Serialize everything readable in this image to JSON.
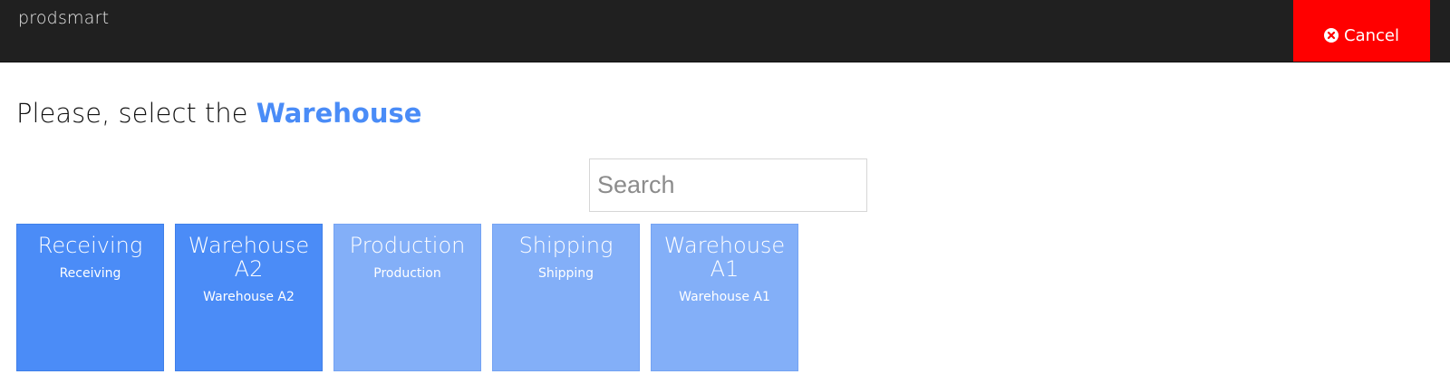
{
  "header": {
    "brand": "prodsmart",
    "cancel_label": "Cancel"
  },
  "heading": {
    "prefix": "Please, select the",
    "emphasis": "Warehouse"
  },
  "search": {
    "placeholder": "Search",
    "value": ""
  },
  "tiles": [
    {
      "title": "Receiving",
      "subtitle": "Receiving",
      "selected": true
    },
    {
      "title": "Warehouse A2",
      "subtitle": "Warehouse A2",
      "selected": true
    },
    {
      "title": "Production",
      "subtitle": "Production",
      "selected": false
    },
    {
      "title": "Shipping",
      "subtitle": "Shipping",
      "selected": false
    },
    {
      "title": "Warehouse A1",
      "subtitle": "Warehouse A1",
      "selected": false
    }
  ],
  "colors": {
    "topbar": "#202020",
    "cancel": "#ff0000",
    "accent": "#4a8cf7",
    "tile_dark": "#4b8cf7",
    "tile_light": "#83aff8"
  },
  "icons": {
    "cancel": "close-circle-icon"
  }
}
